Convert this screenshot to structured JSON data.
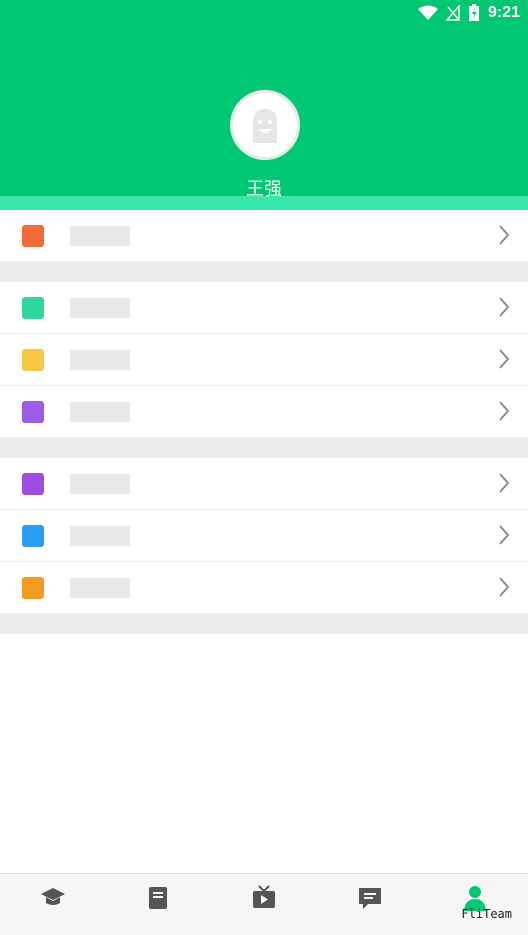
{
  "status_bar": {
    "time": "9:21"
  },
  "profile": {
    "name": "王强"
  },
  "menu_groups": [
    [
      {
        "icon": "clipboard-icon",
        "color": "#f26a3a",
        "label": ""
      }
    ],
    [
      {
        "icon": "video-icon",
        "color": "#2fd79c",
        "label": ""
      },
      {
        "icon": "cart-icon",
        "color": "#f7c842",
        "label": ""
      },
      {
        "icon": "wallet-icon",
        "color": "#9b5de5",
        "label": ""
      }
    ],
    [
      {
        "icon": "coupon-icon",
        "color": "#a04de3",
        "label": ""
      },
      {
        "icon": "diamond-icon",
        "color": "#2a9df4",
        "label": ""
      },
      {
        "icon": "settings-gear-icon",
        "color": "#f39a1f",
        "label": ""
      }
    ]
  ],
  "tabs": [
    {
      "icon": "graduation-cap-icon",
      "label": ""
    },
    {
      "icon": "book-icon",
      "label": ""
    },
    {
      "icon": "tv-play-icon",
      "label": ""
    },
    {
      "icon": "message-icon",
      "label": ""
    },
    {
      "icon": "profile-person-icon",
      "label": "",
      "active": true
    }
  ],
  "colors": {
    "accent": "#00c872",
    "wave": "#2de5a4"
  },
  "watermark": "FliTeam"
}
